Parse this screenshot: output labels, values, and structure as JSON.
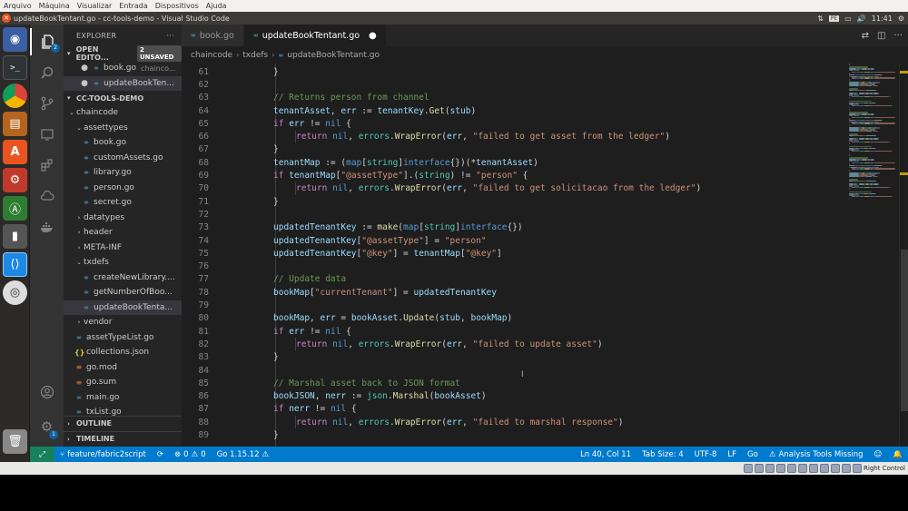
{
  "vbox_menu": [
    "Arquivo",
    "Máquina",
    "Visualizar",
    "Entrada",
    "Dispositivos",
    "Ajuda"
  ],
  "window_title": "updateBookTentant.go - cc-tools-demo - Visual Studio Code",
  "tray": {
    "keyboard": "PE",
    "sound": "🔊",
    "time": "11:41"
  },
  "explorer": {
    "title": "EXPLORER",
    "more": "···",
    "open_editors": {
      "label": "OPEN EDITO...",
      "unsaved": "2 UNSAVED"
    },
    "open_files": [
      {
        "name": "book.go",
        "desc": "chainco..."
      },
      {
        "name": "updateBookTen...",
        "desc": ""
      }
    ],
    "project": "CC-TOOLS-DEMO",
    "tree": [
      {
        "type": "folder",
        "name": "chaincode",
        "indent": 1,
        "open": true
      },
      {
        "type": "folder",
        "name": "assettypes",
        "indent": 2,
        "open": true
      },
      {
        "type": "go",
        "name": "book.go",
        "indent": 3
      },
      {
        "type": "go",
        "name": "customAssets.go",
        "indent": 3
      },
      {
        "type": "go",
        "name": "library.go",
        "indent": 3
      },
      {
        "type": "go",
        "name": "person.go",
        "indent": 3
      },
      {
        "type": "go",
        "name": "secret.go",
        "indent": 3
      },
      {
        "type": "folder",
        "name": "datatypes",
        "indent": 2,
        "open": false
      },
      {
        "type": "folder",
        "name": "header",
        "indent": 2,
        "open": false
      },
      {
        "type": "folder",
        "name": "META-INF",
        "indent": 2,
        "open": false
      },
      {
        "type": "folder",
        "name": "txdefs",
        "indent": 2,
        "open": true
      },
      {
        "type": "go",
        "name": "createNewLibrary....",
        "indent": 3
      },
      {
        "type": "go",
        "name": "getNumberOfBoo...",
        "indent": 3
      },
      {
        "type": "go",
        "name": "updateBookTenta...",
        "indent": 3,
        "selected": true
      },
      {
        "type": "folder",
        "name": "vendor",
        "indent": 2,
        "open": false
      },
      {
        "type": "go",
        "name": "assetTypeList.go",
        "indent": 2
      },
      {
        "type": "json",
        "name": "collections.json",
        "indent": 2
      },
      {
        "type": "mod",
        "name": "go.mod",
        "indent": 2
      },
      {
        "type": "sum",
        "name": "go.sum",
        "indent": 2
      },
      {
        "type": "go",
        "name": "main.go",
        "indent": 2
      },
      {
        "type": "go",
        "name": "txList.go",
        "indent": 2
      }
    ],
    "outline": "OUTLINE",
    "timeline": "TIMELINE"
  },
  "tabs": [
    {
      "name": "book.go",
      "active": false,
      "modified": false
    },
    {
      "name": "updateBookTentant.go",
      "active": true,
      "modified": true
    }
  ],
  "breadcrumb": [
    "chaincode",
    "txdefs",
    "updateBookTentant.go"
  ],
  "code_lines": [
    {
      "n": "61",
      "indent": 1,
      "tokens": [
        [
          "}",
          "p"
        ]
      ]
    },
    {
      "n": "62",
      "indent": 0,
      "tokens": []
    },
    {
      "n": "63",
      "indent": 1,
      "tokens": [
        [
          "// Returns person from channel",
          "m"
        ]
      ]
    },
    {
      "n": "64",
      "indent": 1,
      "tokens": [
        [
          "tenantAsset",
          "v"
        ],
        [
          ", ",
          "p"
        ],
        [
          "err",
          "v"
        ],
        [
          " := ",
          "p"
        ],
        [
          "tenantKey",
          "v"
        ],
        [
          ".",
          "p"
        ],
        [
          "Get",
          "f"
        ],
        [
          "(",
          "p"
        ],
        [
          "stub",
          "v"
        ],
        [
          ")",
          "p"
        ]
      ]
    },
    {
      "n": "65",
      "indent": 1,
      "tokens": [
        [
          "if",
          "c"
        ],
        [
          " ",
          "p"
        ],
        [
          "err",
          "v"
        ],
        [
          " != ",
          "p"
        ],
        [
          "nil",
          "k"
        ],
        [
          " {",
          "p"
        ]
      ]
    },
    {
      "n": "66",
      "indent": 2,
      "tokens": [
        [
          "return",
          "c"
        ],
        [
          " ",
          "p"
        ],
        [
          "nil",
          "k"
        ],
        [
          ", ",
          "p"
        ],
        [
          "errors",
          "t"
        ],
        [
          ".",
          "p"
        ],
        [
          "WrapError",
          "f"
        ],
        [
          "(",
          "p"
        ],
        [
          "err",
          "v"
        ],
        [
          ", ",
          "p"
        ],
        [
          "\"failed to get asset from the ledger\"",
          "s"
        ],
        [
          ")",
          "p"
        ]
      ]
    },
    {
      "n": "67",
      "indent": 1,
      "tokens": [
        [
          "}",
          "p"
        ]
      ]
    },
    {
      "n": "68",
      "indent": 1,
      "tokens": [
        [
          "tenantMap",
          "v"
        ],
        [
          " := (",
          "p"
        ],
        [
          "map",
          "k"
        ],
        [
          "[",
          "p"
        ],
        [
          "string",
          "t"
        ],
        [
          "]",
          "p"
        ],
        [
          "interface",
          "k"
        ],
        [
          "{})(*",
          "p"
        ],
        [
          "tenantAsset",
          "v"
        ],
        [
          ")",
          "p"
        ]
      ]
    },
    {
      "n": "69",
      "indent": 1,
      "tokens": [
        [
          "if",
          "c"
        ],
        [
          " ",
          "p"
        ],
        [
          "tenantMap",
          "v"
        ],
        [
          "[",
          "p"
        ],
        [
          "\"@assetType\"",
          "s"
        ],
        [
          "].(",
          "p"
        ],
        [
          "string",
          "t"
        ],
        [
          ") != ",
          "p"
        ],
        [
          "\"person\"",
          "s"
        ],
        [
          " {",
          "p"
        ]
      ]
    },
    {
      "n": "70",
      "indent": 2,
      "tokens": [
        [
          "return",
          "c"
        ],
        [
          " ",
          "p"
        ],
        [
          "nil",
          "k"
        ],
        [
          ", ",
          "p"
        ],
        [
          "errors",
          "t"
        ],
        [
          ".",
          "p"
        ],
        [
          "WrapError",
          "f"
        ],
        [
          "(",
          "p"
        ],
        [
          "err",
          "v"
        ],
        [
          ", ",
          "p"
        ],
        [
          "\"failed to get solicitacao from the ledger\"",
          "s"
        ],
        [
          ")",
          "p"
        ]
      ]
    },
    {
      "n": "71",
      "indent": 1,
      "tokens": [
        [
          "}",
          "p"
        ]
      ]
    },
    {
      "n": "72",
      "indent": 0,
      "tokens": []
    },
    {
      "n": "73",
      "indent": 1,
      "tokens": [
        [
          "updatedTenantKey",
          "v"
        ],
        [
          " := ",
          "p"
        ],
        [
          "make",
          "f"
        ],
        [
          "(",
          "p"
        ],
        [
          "map",
          "k"
        ],
        [
          "[",
          "p"
        ],
        [
          "string",
          "t"
        ],
        [
          "]",
          "p"
        ],
        [
          "interface",
          "k"
        ],
        [
          "{})",
          "p"
        ]
      ]
    },
    {
      "n": "74",
      "indent": 1,
      "tokens": [
        [
          "updatedTenantKey",
          "v"
        ],
        [
          "[",
          "p"
        ],
        [
          "\"@assetType\"",
          "s"
        ],
        [
          "] = ",
          "p"
        ],
        [
          "\"person\"",
          "s"
        ]
      ]
    },
    {
      "n": "75",
      "indent": 1,
      "tokens": [
        [
          "updatedTenantKey",
          "v"
        ],
        [
          "[",
          "p"
        ],
        [
          "\"@key\"",
          "s"
        ],
        [
          "] = ",
          "p"
        ],
        [
          "tenantMap",
          "v"
        ],
        [
          "[",
          "p"
        ],
        [
          "\"@key\"",
          "s"
        ],
        [
          "]",
          "p"
        ]
      ]
    },
    {
      "n": "76",
      "indent": 0,
      "tokens": []
    },
    {
      "n": "77",
      "indent": 1,
      "tokens": [
        [
          "// Update data",
          "m"
        ]
      ]
    },
    {
      "n": "78",
      "indent": 1,
      "tokens": [
        [
          "bookMap",
          "v"
        ],
        [
          "[",
          "p"
        ],
        [
          "\"currentTenant\"",
          "s"
        ],
        [
          "] = ",
          "p"
        ],
        [
          "updatedTenantKey",
          "v"
        ]
      ]
    },
    {
      "n": "79",
      "indent": 0,
      "tokens": []
    },
    {
      "n": "80",
      "indent": 1,
      "tokens": [
        [
          "bookMap",
          "v"
        ],
        [
          ", ",
          "p"
        ],
        [
          "err",
          "v"
        ],
        [
          " = ",
          "p"
        ],
        [
          "bookAsset",
          "v"
        ],
        [
          ".",
          "p"
        ],
        [
          "Update",
          "f"
        ],
        [
          "(",
          "p"
        ],
        [
          "stub",
          "v"
        ],
        [
          ", ",
          "p"
        ],
        [
          "bookMap",
          "v"
        ],
        [
          ")",
          "p"
        ]
      ]
    },
    {
      "n": "81",
      "indent": 1,
      "tokens": [
        [
          "if",
          "c"
        ],
        [
          " ",
          "p"
        ],
        [
          "err",
          "v"
        ],
        [
          " != ",
          "p"
        ],
        [
          "nil",
          "k"
        ],
        [
          " {",
          "p"
        ]
      ]
    },
    {
      "n": "82",
      "indent": 2,
      "tokens": [
        [
          "return",
          "c"
        ],
        [
          " ",
          "p"
        ],
        [
          "nil",
          "k"
        ],
        [
          ", ",
          "p"
        ],
        [
          "errors",
          "t"
        ],
        [
          ".",
          "p"
        ],
        [
          "WrapError",
          "f"
        ],
        [
          "(",
          "p"
        ],
        [
          "err",
          "v"
        ],
        [
          ", ",
          "p"
        ],
        [
          "\"failed to update asset\"",
          "s"
        ],
        [
          ")",
          "p"
        ]
      ]
    },
    {
      "n": "83",
      "indent": 1,
      "tokens": [
        [
          "}",
          "p"
        ]
      ]
    },
    {
      "n": "84",
      "indent": 0,
      "tokens": []
    },
    {
      "n": "85",
      "indent": 1,
      "tokens": [
        [
          "// Marshal asset back to JSON format",
          "m"
        ]
      ]
    },
    {
      "n": "86",
      "indent": 1,
      "tokens": [
        [
          "bookJSON",
          "v"
        ],
        [
          ", ",
          "p"
        ],
        [
          "nerr",
          "v"
        ],
        [
          " := ",
          "p"
        ],
        [
          "json",
          "t"
        ],
        [
          ".",
          "p"
        ],
        [
          "Marshal",
          "f"
        ],
        [
          "(",
          "p"
        ],
        [
          "bookAsset",
          "v"
        ],
        [
          ")",
          "p"
        ]
      ]
    },
    {
      "n": "87",
      "indent": 1,
      "tokens": [
        [
          "if",
          "c"
        ],
        [
          " ",
          "p"
        ],
        [
          "nerr",
          "v"
        ],
        [
          " != ",
          "p"
        ],
        [
          "nil",
          "k"
        ],
        [
          " {",
          "p"
        ]
      ]
    },
    {
      "n": "88",
      "indent": 2,
      "tokens": [
        [
          "return",
          "c"
        ],
        [
          " ",
          "p"
        ],
        [
          "nil",
          "k"
        ],
        [
          ", ",
          "p"
        ],
        [
          "errors",
          "t"
        ],
        [
          ".",
          "p"
        ],
        [
          "WrapError",
          "f"
        ],
        [
          "(",
          "p"
        ],
        [
          "err",
          "v"
        ],
        [
          ", ",
          "p"
        ],
        [
          "\"failed to marshal response\"",
          "s"
        ],
        [
          ")",
          "p"
        ]
      ]
    },
    {
      "n": "89",
      "indent": 1,
      "tokens": [
        [
          "}",
          "p"
        ]
      ]
    }
  ],
  "status": {
    "branch": "feature/fabric2script",
    "sync": "⟳",
    "errors": "0",
    "warnings": "0",
    "go_version": "Go 1.15.12",
    "position": "Ln 40, Col 11",
    "tab_size": "Tab Size: 4",
    "encoding": "UTF-8",
    "eol": "LF",
    "language": "Go",
    "analysis": "Analysis Tools Missing"
  },
  "vbox_status": {
    "host_key": "Right Control"
  },
  "colors": {
    "statusbar": "#007acc",
    "editor_bg": "#1e1e1e",
    "sidebar_bg": "#252526",
    "activity_bg": "#333333",
    "launcher_bg": "#2b2a29",
    "ubuntu_orange": "#e95420"
  }
}
